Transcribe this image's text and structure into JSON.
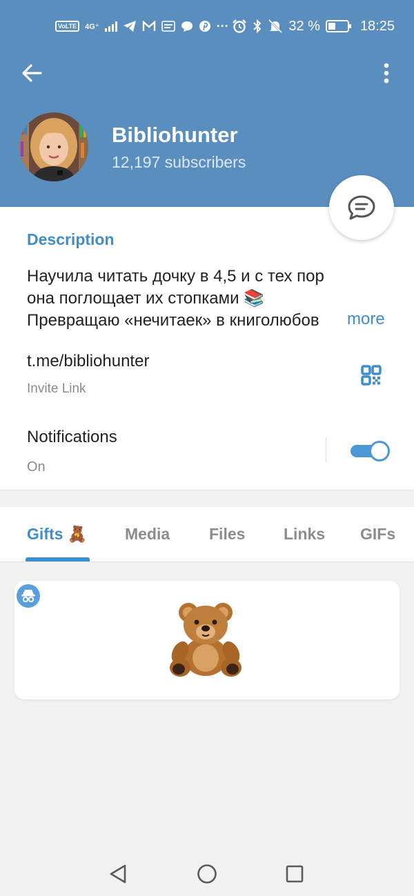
{
  "status_bar": {
    "volte": "VoLTE",
    "network": "4G⁺",
    "battery_percent": "32 %",
    "time": "18:25",
    "more_dots": "···"
  },
  "channel": {
    "name": "Bibliohunter",
    "subscribers": "12,197 subscribers"
  },
  "description": {
    "title": "Description",
    "line1": "Научила читать дочку в 4,5 и с тех пор",
    "line2": "она поглощает их стопками 📚",
    "line3": "Превращаю «нечитаек» в книголюбов",
    "more": "more"
  },
  "invite": {
    "link": "t.me/bibliohunter",
    "label": "Invite Link"
  },
  "notifications": {
    "title": "Notifications",
    "status": "On",
    "enabled": true
  },
  "tabs": [
    {
      "label": "Gifts 🧸",
      "active": true
    },
    {
      "label": "Media",
      "active": false
    },
    {
      "label": "Files",
      "active": false
    },
    {
      "label": "Links",
      "active": false
    },
    {
      "label": "GIFs",
      "active": false
    }
  ],
  "colors": {
    "header": "#5a8ebf",
    "accent": "#3d8ecb",
    "toggle": "#4a97d6"
  },
  "icons": {
    "back": "arrow-left-icon",
    "menu": "more-vertical-icon",
    "fab": "chat-bubble-icon",
    "qr": "qr-code-icon",
    "gift": "teddy-bear-icon",
    "badge": "anonymous-icon"
  }
}
